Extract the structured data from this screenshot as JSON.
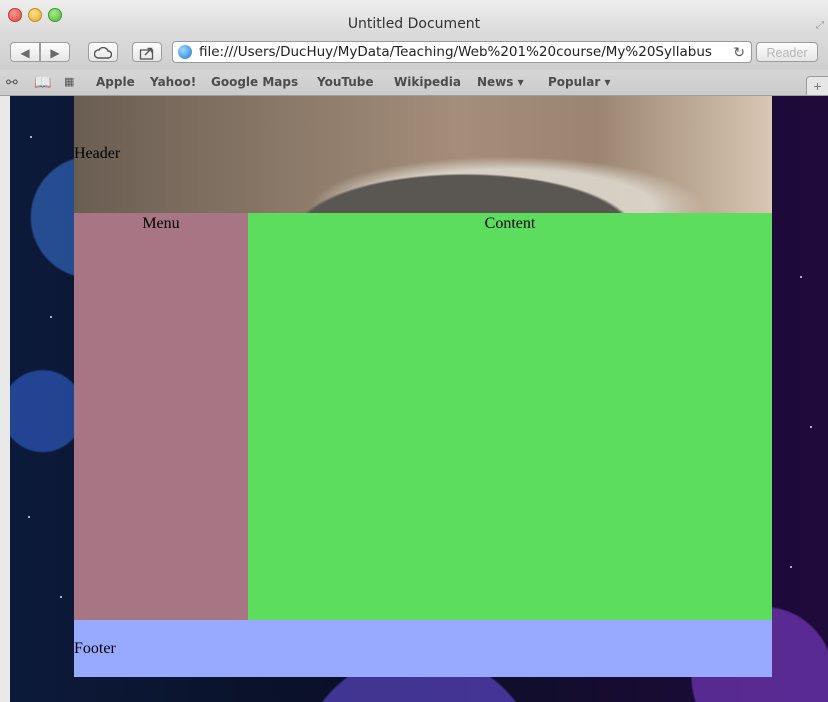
{
  "window": {
    "title": "Untitled Document"
  },
  "toolbar": {
    "back_label": "◀",
    "forward_label": "▶",
    "url": "file:///Users/DucHuy/MyData/Teaching/Web%201%20course/My%20Syllabus",
    "reload_icon": "reload-icon",
    "reader_label": "Reader"
  },
  "bookmarks": {
    "items": [
      {
        "label": "Apple"
      },
      {
        "label": "Yahoo!"
      },
      {
        "label": "Google Maps"
      },
      {
        "label": "YouTube"
      },
      {
        "label": "Wikipedia"
      },
      {
        "label": "News ▾"
      },
      {
        "label": "Popular ▾"
      }
    ]
  },
  "page": {
    "header": "Header",
    "menu": "Menu",
    "content": "Content",
    "footer": "Footer"
  },
  "colors": {
    "menu_bg": "#a87585",
    "content_bg": "#5ddd5d",
    "footer_bg": "#98aaff"
  }
}
